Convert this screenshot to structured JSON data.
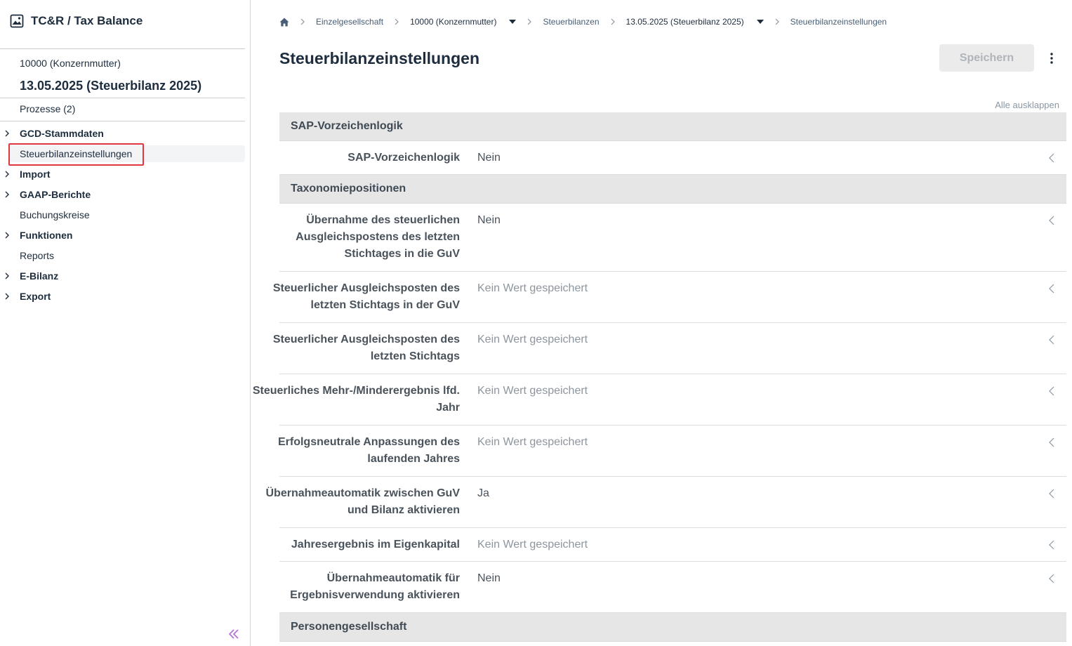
{
  "app": {
    "title": "TC&R / Tax Balance",
    "icon": "image-icon"
  },
  "sidebar": {
    "entity": "10000 (Konzernmutter)",
    "balance": "13.05.2025 (Steuerbilanz 2025)",
    "processes": "Prozesse (2)",
    "items": [
      {
        "label": "GCD-Stammdaten",
        "expandable": true,
        "bold": true
      },
      {
        "label": "Steuerbilanzeinstellungen",
        "expandable": false,
        "bold": false,
        "selected": true
      },
      {
        "label": "Import",
        "expandable": true,
        "bold": true
      },
      {
        "label": "GAAP-Berichte",
        "expandable": true,
        "bold": true
      },
      {
        "label": "Buchungskreise",
        "expandable": false,
        "bold": false
      },
      {
        "label": "Funktionen",
        "expandable": true,
        "bold": true
      },
      {
        "label": "Reports",
        "expandable": false,
        "bold": false
      },
      {
        "label": "E-Bilanz",
        "expandable": true,
        "bold": true
      },
      {
        "label": "Export",
        "expandable": true,
        "bold": true
      }
    ],
    "collapse_icon": "double-chevron-left-icon"
  },
  "breadcrumb": [
    {
      "label": "Einzelgesellschaft"
    },
    {
      "label": "10000 (Konzernmutter)",
      "dropdown": true
    },
    {
      "label": "Steuerbilanzen"
    },
    {
      "label": "13.05.2025 (Steuerbilanz 2025)",
      "dropdown": true
    },
    {
      "label": "Steuerbilanzeinstellungen"
    }
  ],
  "page": {
    "title": "Steuerbilanzeinstellungen",
    "save_label": "Speichern",
    "expand_all": "Alle ausklappen"
  },
  "sections": [
    {
      "title": "SAP-Vorzeichenlogik",
      "rows": [
        {
          "label": "SAP-Vorzeichenlogik",
          "value": "Nein",
          "empty": false
        }
      ]
    },
    {
      "title": "Taxonomiepositionen",
      "rows": [
        {
          "label": "Übernahme des steuerlichen Ausgleichspostens des letzten Stichtages in die GuV",
          "value": "Nein",
          "empty": false
        },
        {
          "label": "Steuerlicher Ausgleichsposten des letzten Stichtags in der GuV",
          "value": "Kein Wert gespeichert",
          "empty": true
        },
        {
          "label": "Steuerlicher Ausgleichsposten des letzten Stichtags",
          "value": "Kein Wert gespeichert",
          "empty": true
        },
        {
          "label": "Steuerliches Mehr-/Minderergebnis lfd. Jahr",
          "value": "Kein Wert gespeichert",
          "empty": true
        },
        {
          "label": "Erfolgsneutrale Anpassungen des laufenden Jahres",
          "value": "Kein Wert gespeichert",
          "empty": true
        },
        {
          "label": "Übernahmeautomatik zwischen GuV und Bilanz aktivieren",
          "value": "Ja",
          "empty": false
        },
        {
          "label": "Jahresergebnis im Eigenkapital",
          "value": "Kein Wert gespeichert",
          "empty": true
        },
        {
          "label": "Übernahmeautomatik für Ergebnisverwendung aktivieren",
          "value": "Nein",
          "empty": false
        }
      ]
    },
    {
      "title": "Personengesellschaft",
      "rows": []
    }
  ]
}
